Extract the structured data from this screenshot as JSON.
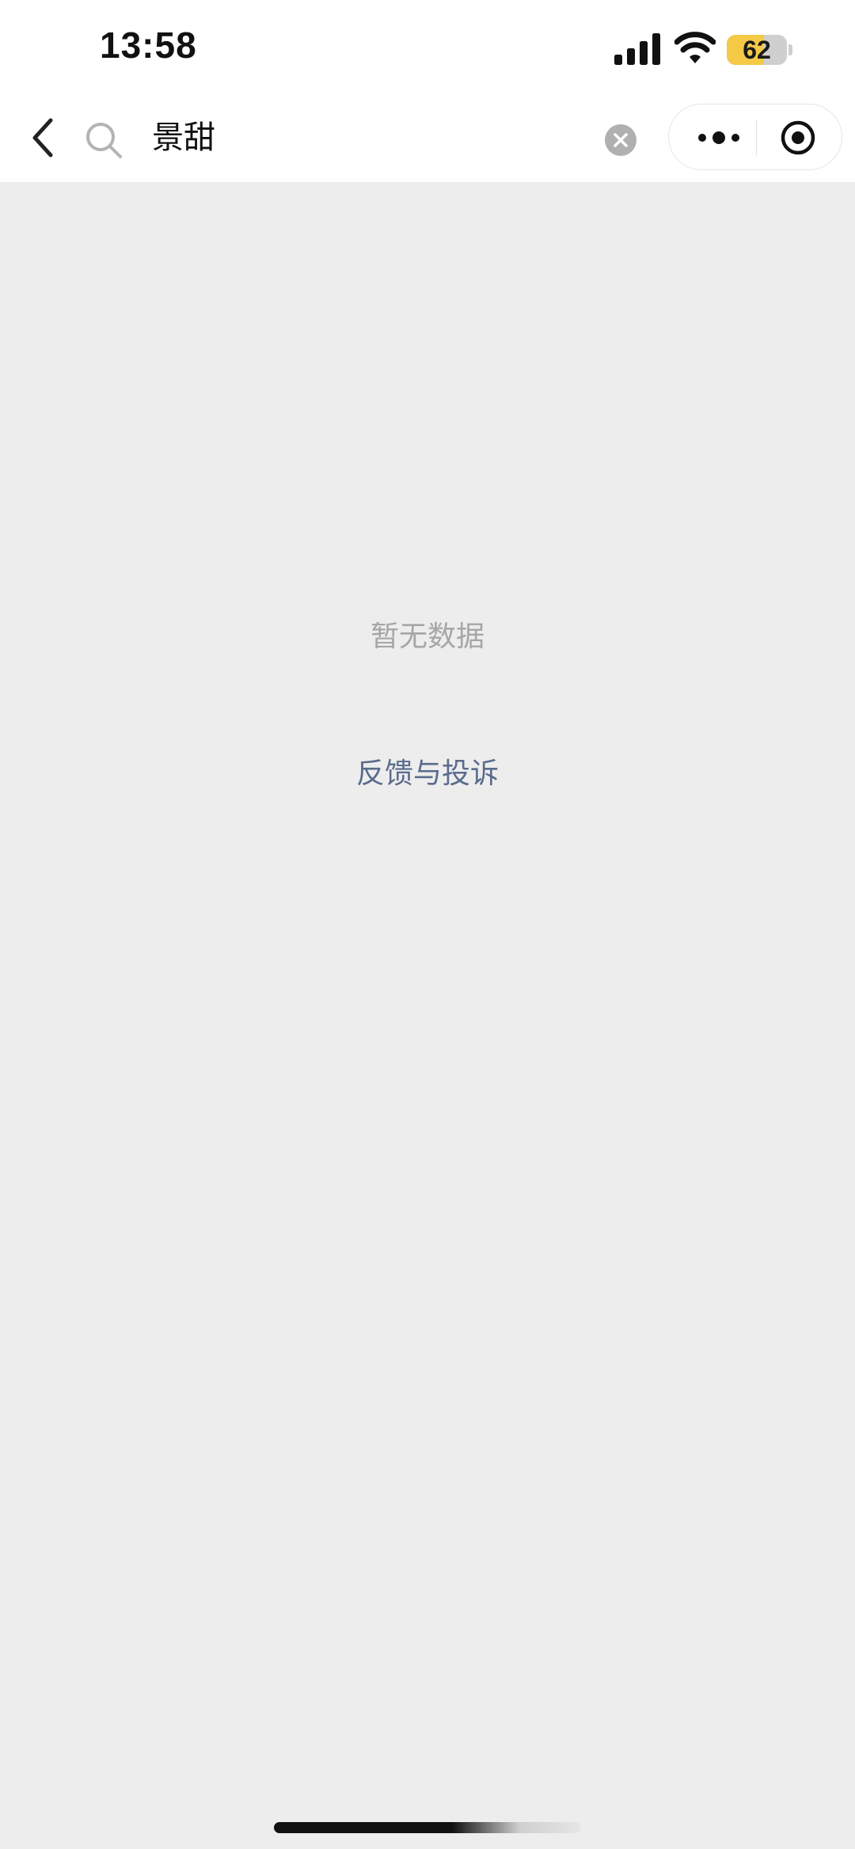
{
  "status_bar": {
    "time": "13:58",
    "battery_level": "62",
    "battery_fraction": 0.62,
    "signal_icon": "cellular-signal-icon",
    "wifi_icon": "wifi-icon"
  },
  "nav": {
    "back_icon": "chevron-left-icon",
    "search_icon": "magnifier-icon",
    "search_query": "景甜",
    "clear_icon": "clear-circle-x-icon",
    "more_icon": "more-dots-icon",
    "close_icon": "target-circle-icon"
  },
  "content": {
    "empty_message": "暂无数据",
    "feedback_link": "反馈与投诉"
  },
  "colors": {
    "background": "#ededed",
    "link": "#5a6b8c",
    "battery_accent": "#f4c946"
  }
}
